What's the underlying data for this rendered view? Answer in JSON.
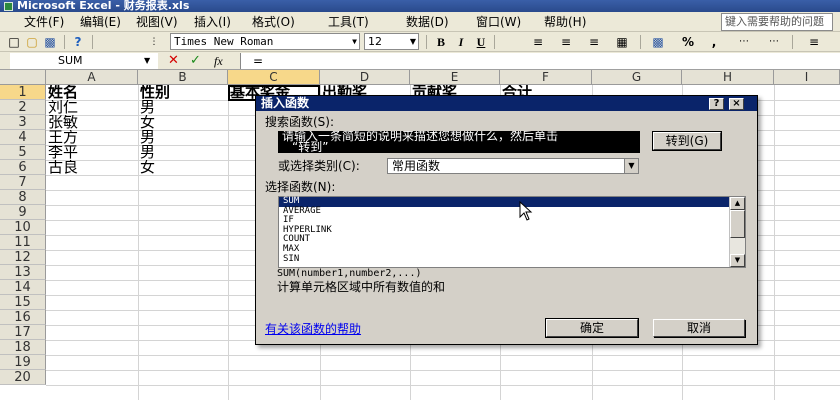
{
  "window": {
    "title": "Microsoft Excel - 财务报表.xls"
  },
  "menu": {
    "items": [
      "文件(F)",
      "编辑(E)",
      "视图(V)",
      "插入(I)",
      "格式(O)",
      "工具(T)",
      "数据(D)",
      "窗口(W)",
      "帮助(H)"
    ],
    "help_placeholder": "键入需要帮助的问题"
  },
  "toolbar": {
    "font_name": "Times New Roman",
    "font_size": "12",
    "bold": "B",
    "italic": "I",
    "underline": "U",
    "percent": "%",
    "comma": ","
  },
  "formula_bar": {
    "name_box": "SUM",
    "fx_label": "fx",
    "formula": "="
  },
  "sheet": {
    "columns": [
      "A",
      "B",
      "C",
      "D",
      "E",
      "F",
      "G",
      "H",
      "I"
    ],
    "rows": [
      "1",
      "2",
      "3",
      "4",
      "5",
      "6",
      "7",
      "8",
      "9",
      "10",
      "11",
      "12",
      "13",
      "14",
      "15",
      "16",
      "17",
      "18",
      "19",
      "20"
    ],
    "headers": [
      "姓名",
      "性别",
      "基本奖金",
      "出勤奖",
      "贡献奖",
      "合计"
    ],
    "records": [
      {
        "name": "刘仁",
        "gender": "男"
      },
      {
        "name": "张敏",
        "gender": "女"
      },
      {
        "name": "王方",
        "gender": "男"
      },
      {
        "name": "李平",
        "gender": "男"
      },
      {
        "name": "古良",
        "gender": "女"
      }
    ]
  },
  "dialog": {
    "title": "插入函数",
    "search_label": "搜索函数(S):",
    "search_text_line1": "请输入一条简短的说明来描述您想做什么，然后单击",
    "search_text_line2": "“转到”",
    "goto_button": "转到(G)",
    "category_label": "或选择类别(C):",
    "category_value": "常用函数",
    "select_label": "选择函数(N):",
    "functions": [
      "SUM",
      "AVERAGE",
      "IF",
      "HYPERLINK",
      "COUNT",
      "MAX",
      "SIN"
    ],
    "selected_function": "SUM",
    "syntax": "SUM(number1,number2,...)",
    "description": "计算单元格区域中所有数值的和",
    "help_link": "有关该函数的帮助",
    "ok_button": "确定",
    "cancel_button": "取消",
    "help_button": "?",
    "close_button": "×"
  }
}
